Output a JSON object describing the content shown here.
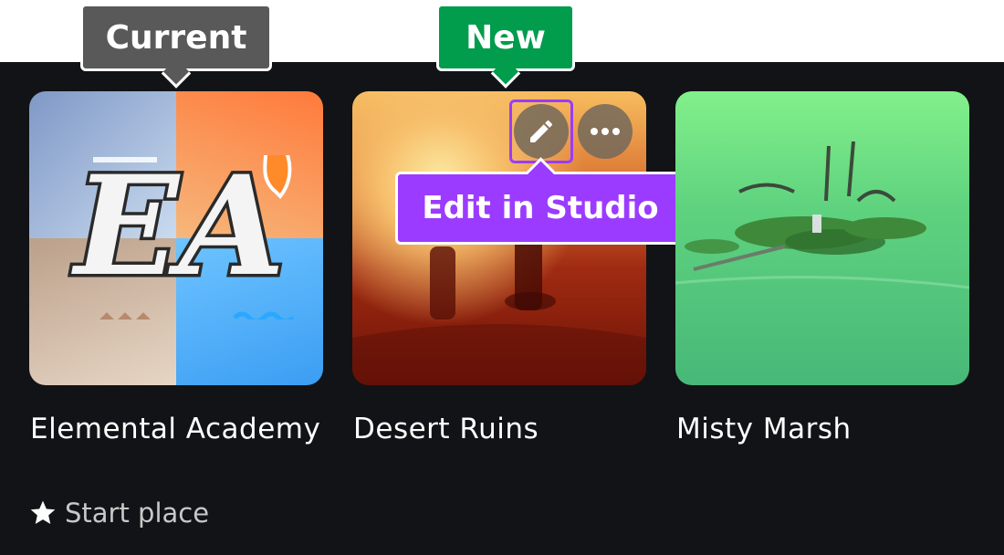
{
  "tags": {
    "current": "Current",
    "new": "New"
  },
  "places": [
    {
      "title": "Elemental Academy",
      "thumb_text": "EA",
      "note": "Start place"
    },
    {
      "title": "Desert Ruins"
    },
    {
      "title": "Misty Marsh"
    }
  ],
  "tooltip": {
    "text": "Edit in Studio"
  },
  "icons": {
    "edit": "pencil-icon",
    "more": "more-options-icon",
    "start": "star-icon"
  },
  "colors": {
    "background": "#121316",
    "current_tag": "#595959",
    "new_tag": "#019c4c",
    "tooltip": "#9b3bff"
  }
}
